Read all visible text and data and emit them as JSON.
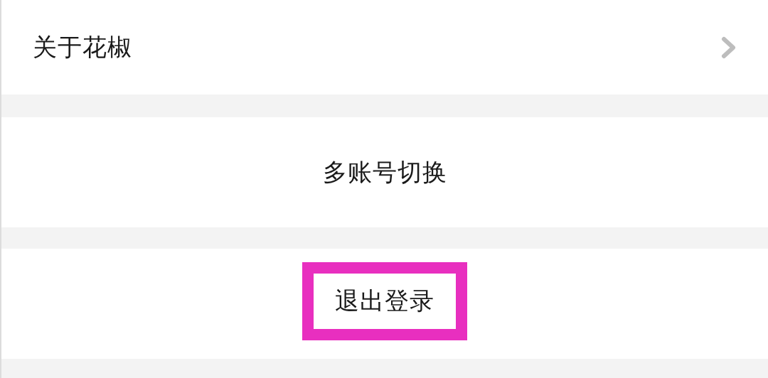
{
  "settings_rows": [
    {
      "kind": "link",
      "label": "关于花椒"
    },
    {
      "kind": "action",
      "label": "多账号切换",
      "highlighted": false
    },
    {
      "kind": "action",
      "label": "退出登录",
      "highlighted": true
    }
  ]
}
